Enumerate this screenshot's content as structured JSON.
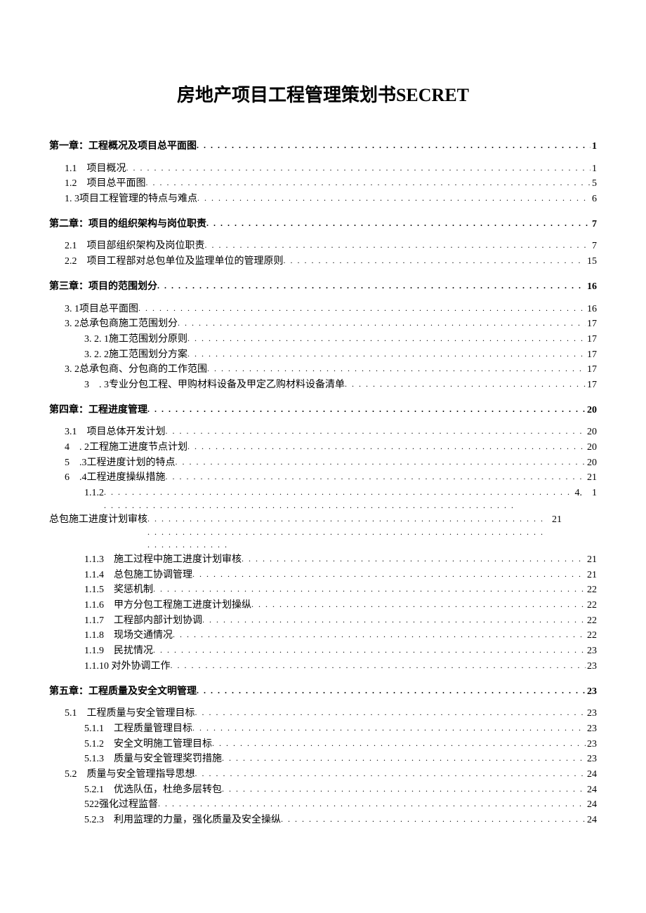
{
  "title": "房地产项目工程管理策划书SECRET",
  "toc": [
    {
      "level": 0,
      "label": "第一章：工程概况及项目总平面图",
      "page": "1"
    },
    {
      "level": 1,
      "label": "1.1　项目概况",
      "page": "1"
    },
    {
      "level": 1,
      "label": "1.2　项目总平面图",
      "page": "5"
    },
    {
      "level": 1,
      "label": "1. 3项目工程管理的特点与难点",
      "page": "6"
    },
    {
      "level": 0,
      "label": "第二章：项目的组织架构与岗位职责",
      "page": "7"
    },
    {
      "level": 1,
      "label": "2.1　项目部组织架构及岗位职责",
      "page": "7"
    },
    {
      "level": 1,
      "label": "2.2　项目工程部对总包单位及监理单位的管理原则",
      "page": "15"
    },
    {
      "level": 0,
      "label": "第三章：项目的范围划分",
      "page": "16"
    },
    {
      "level": 1,
      "label": "3. 1项目总平面图",
      "page": "16"
    },
    {
      "level": 1,
      "label": "3. 2总承包商施工范围划分",
      "page": "17"
    },
    {
      "level": 2,
      "label": "3. 2. 1施工范围划分原则",
      "page": "17"
    },
    {
      "level": 2,
      "label": "3. 2. 2施工范围划分方案",
      "page": "17"
    },
    {
      "level": 1,
      "label": "3. 2总承包商、分包商的工作范围",
      "page": "17"
    },
    {
      "level": 2,
      "label": "3　. 3专业分包工程、甲购材料设备及甲定乙购材料设备清单",
      "page": "17"
    },
    {
      "level": 0,
      "label": "第四章：工程进度管理",
      "page": "20"
    },
    {
      "level": 1,
      "label": "3.1　项目总体开发计划",
      "page": "20"
    },
    {
      "level": 1,
      "label": "4　. 2工程施工进度节点计划",
      "page": "20"
    },
    {
      "level": 1,
      "label": "5　.3工程进度计划的特点",
      "page": "20"
    },
    {
      "level": 1,
      "label": "6　.4工程进度操纵措施",
      "page": "21"
    },
    {
      "level": -1,
      "wrap_leader": "1.1.2",
      "wrap_page_inline": "4.　1",
      "wrap_cont": "总包施工进度计划审核",
      "page": "21"
    },
    {
      "level": 2,
      "label": "1.1.3　施工过程中施工进度计划审核",
      "page": "21"
    },
    {
      "level": 2,
      "label": "1.1.4　总包施工协调管理",
      "page": "21"
    },
    {
      "level": 2,
      "label": "1.1.5　奖惩机制",
      "page": "22"
    },
    {
      "level": 2,
      "label": "1.1.6　甲方分包工程施工进度计划操纵",
      "page": "22"
    },
    {
      "level": 2,
      "label": "1.1.7　工程部内部计划协调",
      "page": "22"
    },
    {
      "level": 2,
      "label": "1.1.8　现场交通情况",
      "page": "22"
    },
    {
      "level": 2,
      "label": "1.1.9　民扰情况",
      "page": "23"
    },
    {
      "level": 2,
      "label": "1.1.10 对外协调工作",
      "page": "23"
    },
    {
      "level": 0,
      "label": "第五章：工程质量及安全文明管理",
      "page": "23"
    },
    {
      "level": 1,
      "label": "5.1　工程质量与安全管理目标",
      "page": "23"
    },
    {
      "level": 2,
      "label": "5.1.1　工程质量管理目标",
      "page": "23"
    },
    {
      "level": 2,
      "label": "5.1.2　安全文明施工管理目标",
      "page": "23"
    },
    {
      "level": 2,
      "label": "5.1.3　质量与安全管理奖罚措施",
      "page": "23"
    },
    {
      "level": 1,
      "label": "5.2　质量与安全管理指导思想",
      "page": "24"
    },
    {
      "level": 2,
      "label": "5.2.1　优选队伍，杜绝多层转包",
      "page": "24"
    },
    {
      "level": 2,
      "label": "522强化过程监督",
      "page": "24"
    },
    {
      "level": 2,
      "label": "5.2.3　利用监理的力量，强化质量及安全操纵",
      "page": "24"
    }
  ]
}
